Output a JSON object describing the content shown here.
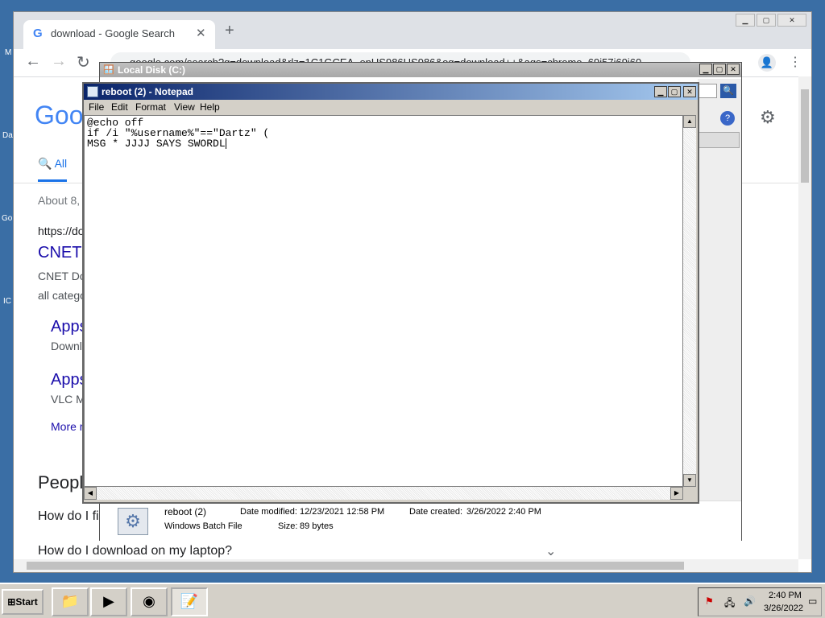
{
  "desktop": {
    "labels": [
      "M",
      "Da",
      "Go",
      "IC"
    ]
  },
  "chrome": {
    "tab_title": "download - Google Search",
    "address": "google.com/search?q=download&rlz=1C1GCEA_enUS986US986&oq=download++&aqs=chrome..69i57j69i60",
    "logo": "Goo",
    "all_tab": "All",
    "results_count": "About 8,",
    "result_url": "https://do",
    "result_title": "CNET",
    "result_snippet": "CNET Do",
    "result_snippet2": "all catego",
    "sub1_title": "Apps",
    "sub1_desc": "Downl",
    "sub2_title": "Apps",
    "sub2_desc": "VLC M",
    "more": "More r",
    "people": "Peopl",
    "q1": "How do I fi",
    "q2": "How do I download on my laptop?"
  },
  "explorer": {
    "title": "Local Disk (C:)",
    "file_name": "reboot (2)",
    "file_type": "Windows Batch File",
    "date_modified_label": "Date modified:",
    "date_modified": "12/23/2021 12:58 PM",
    "date_created_label": "Date created:",
    "date_created": "3/26/2022 2:40 PM",
    "size_label": "Size:",
    "size": "89 bytes"
  },
  "notepad": {
    "title": "reboot (2) - Notepad",
    "menu": [
      "File",
      "Edit",
      "Format",
      "View",
      "Help"
    ],
    "lines": [
      "@echo off",
      "if /i \"%username%\"==\"Dartz\" (",
      "MSG * JJJJ SAYS SWORDL"
    ]
  },
  "taskbar": {
    "start": "Start",
    "time": "2:40 PM",
    "date": "3/26/2022"
  }
}
